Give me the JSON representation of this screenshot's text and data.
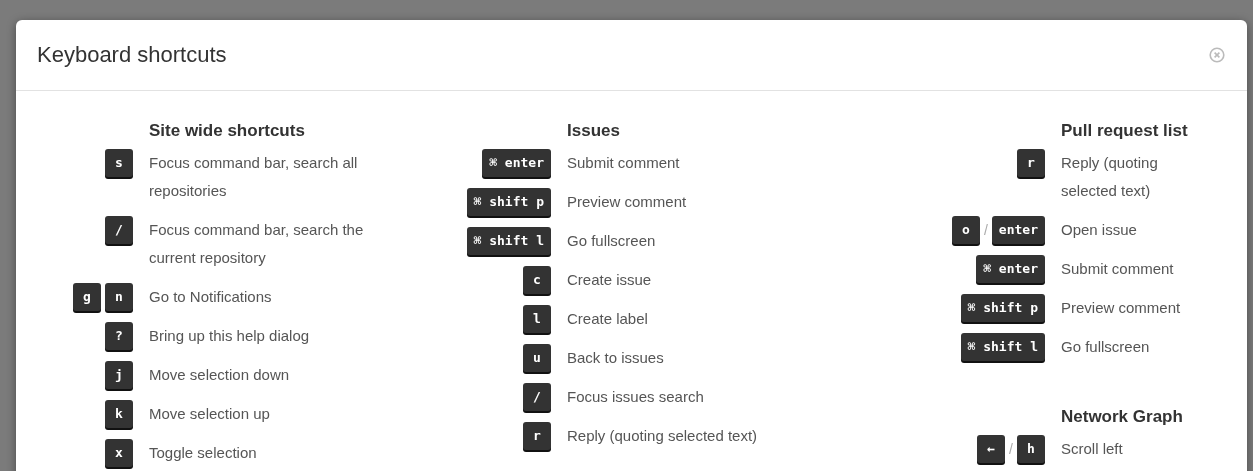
{
  "dialog": {
    "title": "Keyboard shortcuts",
    "columns": [
      {
        "sections": [
          {
            "heading": "Site wide shortcuts",
            "shortcuts": [
              {
                "keys": [
                  {
                    "kind": "key",
                    "label": "s"
                  }
                ],
                "description": "Focus command bar, search all repositories"
              },
              {
                "keys": [
                  {
                    "kind": "key",
                    "label": "/"
                  }
                ],
                "description": "Focus command bar, search the current repository"
              },
              {
                "keys": [
                  {
                    "kind": "key",
                    "label": "g"
                  },
                  {
                    "kind": "key",
                    "label": "n"
                  }
                ],
                "description": "Go to Notifications"
              },
              {
                "keys": [
                  {
                    "kind": "key",
                    "label": "?"
                  }
                ],
                "description": "Bring up this help dialog"
              },
              {
                "keys": [
                  {
                    "kind": "key",
                    "label": "j"
                  }
                ],
                "description": "Move selection down"
              },
              {
                "keys": [
                  {
                    "kind": "key",
                    "label": "k"
                  }
                ],
                "description": "Move selection up"
              },
              {
                "keys": [
                  {
                    "kind": "key",
                    "label": "x"
                  }
                ],
                "description": "Toggle selection"
              }
            ]
          }
        ]
      },
      {
        "sections": [
          {
            "heading": "Issues",
            "shortcuts": [
              {
                "keys": [
                  {
                    "kind": "key",
                    "label": "⌘ enter"
                  }
                ],
                "description": "Submit comment"
              },
              {
                "keys": [
                  {
                    "kind": "key",
                    "label": "⌘ shift p"
                  }
                ],
                "description": "Preview comment"
              },
              {
                "keys": [
                  {
                    "kind": "key",
                    "label": "⌘ shift l"
                  }
                ],
                "description": "Go fullscreen"
              },
              {
                "keys": [
                  {
                    "kind": "key",
                    "label": "c"
                  }
                ],
                "description": "Create issue"
              },
              {
                "keys": [
                  {
                    "kind": "key",
                    "label": "l"
                  }
                ],
                "description": "Create label"
              },
              {
                "keys": [
                  {
                    "kind": "key",
                    "label": "u"
                  }
                ],
                "description": "Back to issues"
              },
              {
                "keys": [
                  {
                    "kind": "key",
                    "label": "/"
                  }
                ],
                "description": "Focus issues search"
              },
              {
                "keys": [
                  {
                    "kind": "key",
                    "label": "r"
                  }
                ],
                "description": "Reply (quoting selected text)"
              }
            ]
          }
        ]
      },
      {
        "sections": [
          {
            "heading": "Pull request list",
            "shortcuts": [
              {
                "keys": [
                  {
                    "kind": "key",
                    "label": "r"
                  }
                ],
                "description": "Reply (quoting selected text)"
              },
              {
                "keys": [
                  {
                    "kind": "key",
                    "label": "o"
                  },
                  {
                    "kind": "separator",
                    "label": "/"
                  },
                  {
                    "kind": "key",
                    "label": "enter"
                  }
                ],
                "description": "Open issue"
              },
              {
                "keys": [
                  {
                    "kind": "key",
                    "label": "⌘ enter"
                  }
                ],
                "description": "Submit comment"
              },
              {
                "keys": [
                  {
                    "kind": "key",
                    "label": "⌘ shift p"
                  }
                ],
                "description": "Preview comment"
              },
              {
                "keys": [
                  {
                    "kind": "key",
                    "label": "⌘ shift l"
                  }
                ],
                "description": "Go fullscreen"
              }
            ]
          },
          {
            "heading": "Network Graph",
            "shortcuts": [
              {
                "keys": [
                  {
                    "kind": "key",
                    "label": "←"
                  },
                  {
                    "kind": "separator",
                    "label": "/"
                  },
                  {
                    "kind": "key",
                    "label": "h"
                  }
                ],
                "description": "Scroll left"
              }
            ]
          }
        ]
      }
    ]
  }
}
